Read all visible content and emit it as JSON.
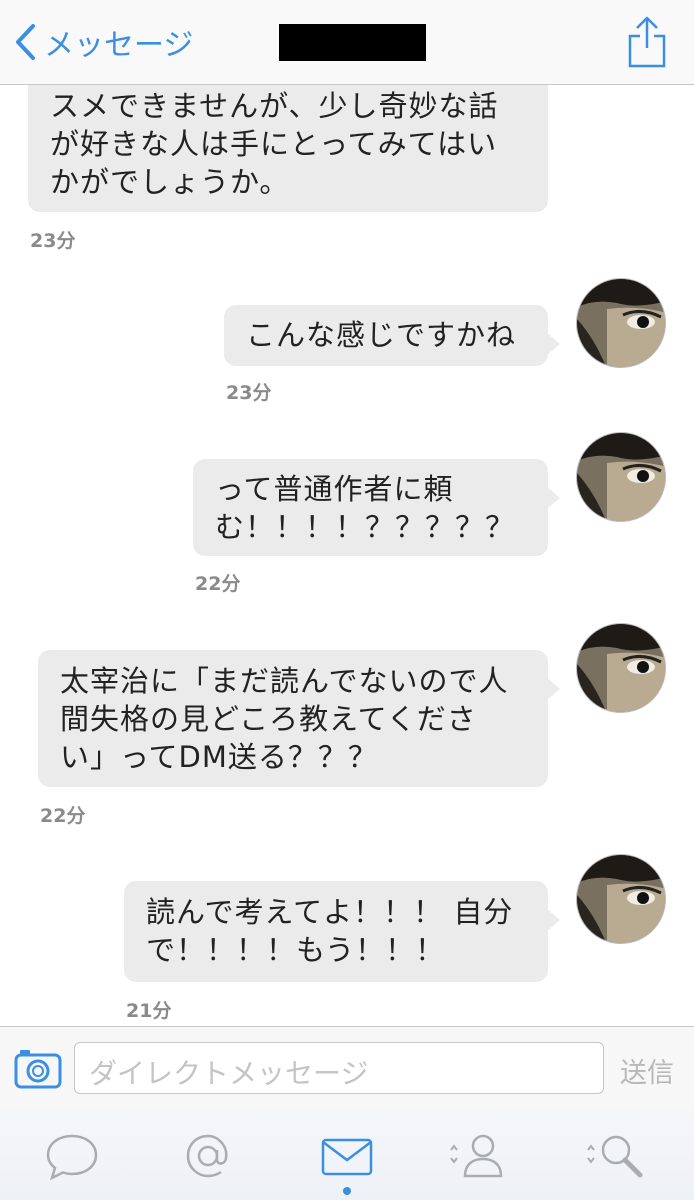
{
  "nav": {
    "back_label": "メッセージ"
  },
  "messages": [
    {
      "side": "left",
      "text": "スメできませんが、少し奇妙な話\nが好きな人は手にとってみてはい\nかがでしょうか。",
      "time": "23分"
    },
    {
      "side": "right",
      "text": "こんな感じですかね",
      "time": "23分"
    },
    {
      "side": "right",
      "text": "って普通作者に頼\nむ！！！！？？？？？",
      "time": "22分"
    },
    {
      "side": "right",
      "text": "太宰治に「まだ読んでないので人\n間失格の見どころ教えてくださ\nい」ってDM送る？？？",
      "time": "22分"
    },
    {
      "side": "right",
      "text": "読んで考えてよ！！！ 自分\nで！！！！もう！！！",
      "time": "21分"
    }
  ],
  "input": {
    "placeholder": "ダイレクトメッセージ",
    "send_label": "送信"
  },
  "tabs": [
    "chat-bubble-icon",
    "at-icon",
    "mail-icon",
    "person-icon",
    "search-icon"
  ],
  "colors": {
    "accent": "#3b8fe3",
    "bubble": "#ebebeb"
  }
}
